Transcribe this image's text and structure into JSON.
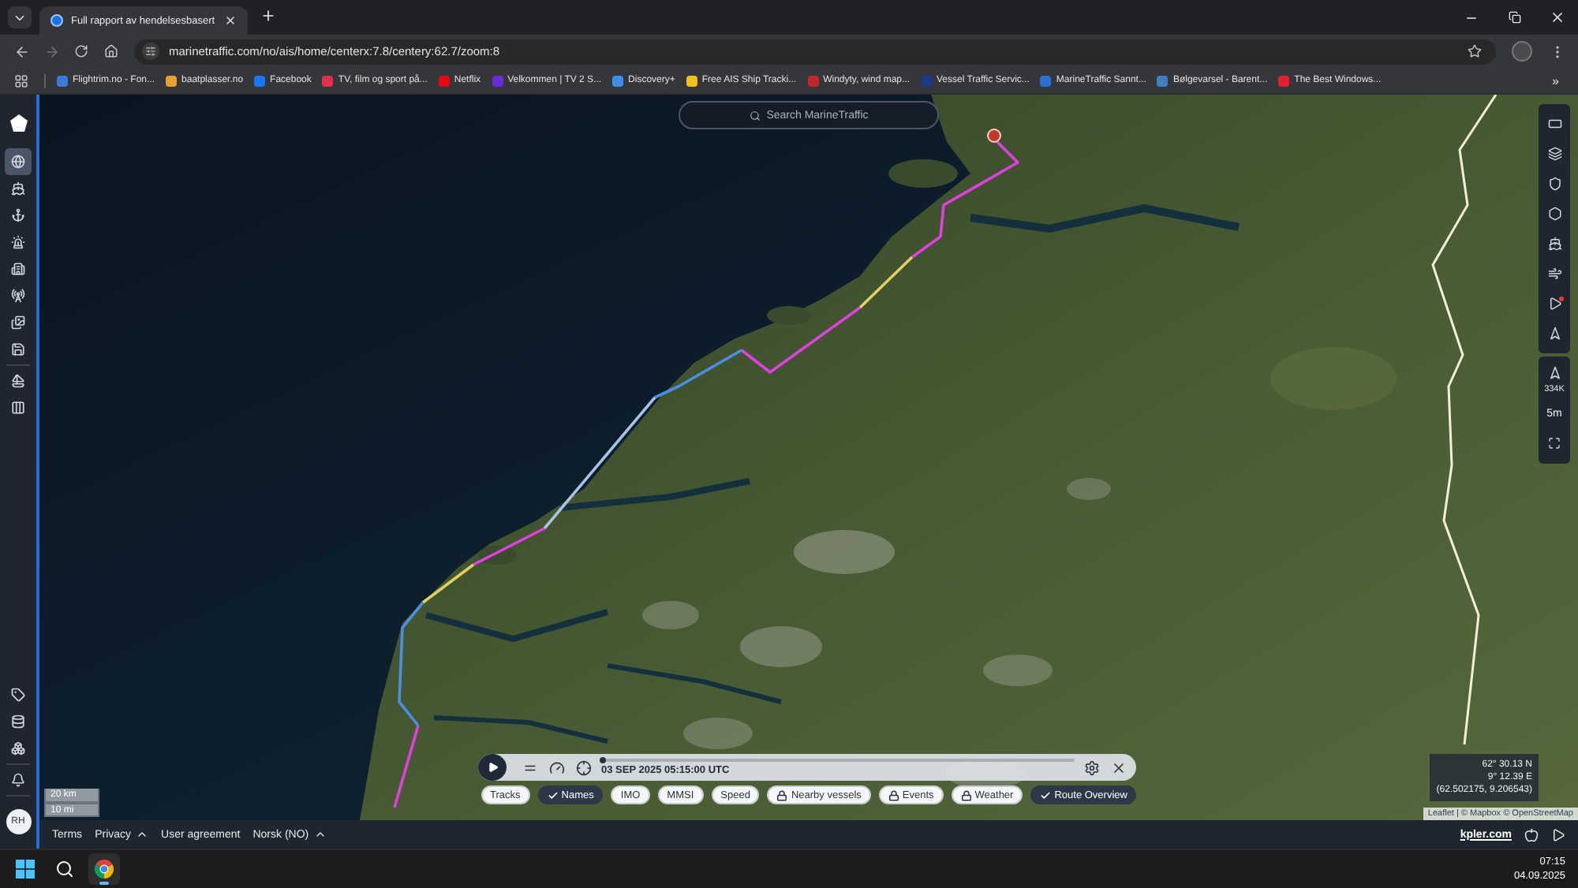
{
  "browser": {
    "tabs": [
      {
        "title": "Full rapport av hendelsesbasert",
        "selected": true
      }
    ],
    "address": "marinetraffic.com/no/ais/home/centerx:7.8/centery:62.7/zoom:8",
    "bookmarks": [
      {
        "label": "Flightrim.no - Fon...",
        "color": "#3a7bd5"
      },
      {
        "label": "baatplasser.no",
        "color": "#e8a030"
      },
      {
        "label": "Facebook",
        "color": "#1877f2"
      },
      {
        "label": "TV, film og sport på...",
        "color": "#e03050"
      },
      {
        "label": "Netflix",
        "color": "#e50914"
      },
      {
        "label": "Velkommen | TV 2 S...",
        "color": "#6a2cd8"
      },
      {
        "label": "Discovery+",
        "color": "#3a8ee6"
      },
      {
        "label": "Free AIS Ship Tracki...",
        "color": "#f0c020"
      },
      {
        "label": "Windyty, wind map...",
        "color": "#c0282a"
      },
      {
        "label": "Vessel Traffic Servic...",
        "color": "#1a3a8a"
      },
      {
        "label": "MarineTraffic Sannt...",
        "color": "#2a6ed0"
      },
      {
        "label": "Bølgevarsel - Barent...",
        "color": "#3f7fbf"
      },
      {
        "label": "The Best Windows...",
        "color": "#e02030"
      }
    ],
    "more": "»"
  },
  "sidebar": {
    "top_groups": [
      [
        {
          "kind": "globe",
          "selected": true
        },
        {
          "kind": "ship",
          "selected": false
        },
        {
          "kind": "anchor",
          "selected": false
        },
        {
          "kind": "siren",
          "selected": false
        },
        {
          "kind": "building",
          "selected": false
        },
        {
          "kind": "antenna",
          "selected": false
        },
        {
          "kind": "images",
          "selected": false
        },
        {
          "kind": "save",
          "selected": false
        }
      ],
      [
        {
          "kind": "sailboat",
          "selected": false
        },
        {
          "kind": "columns",
          "selected": false
        }
      ]
    ],
    "bottom_groups": [
      [
        {
          "kind": "tag",
          "selected": false
        },
        {
          "kind": "database",
          "selected": false
        },
        {
          "kind": "boxes",
          "selected": false
        }
      ],
      [
        {
          "kind": "bell",
          "selected": false
        }
      ]
    ],
    "avatar": "RH"
  },
  "search": {
    "placeholder": "Search MarineTraffic"
  },
  "map_toolbar": [
    {
      "kind": "panel",
      "alert": false
    },
    {
      "kind": "layers",
      "alert": false
    },
    {
      "kind": "shield",
      "alert": false
    },
    {
      "kind": "hexagon",
      "alert": false
    },
    {
      "kind": "ship",
      "alert": false
    },
    {
      "kind": "wind",
      "alert": false
    },
    {
      "kind": "play",
      "alert": true
    },
    {
      "kind": "arrow",
      "alert": false
    }
  ],
  "map_controls": {
    "count": "334K",
    "time_step": "5m"
  },
  "scale": [
    "20 km",
    "10 mi"
  ],
  "coordinates": [
    "62° 30.13 N",
    "9° 12.39 E",
    "(62.502175, 9.206543)"
  ],
  "attribution": "Leaflet | © Mapbox © OpenStreetMap",
  "playback": {
    "level": 0,
    "timestamp": "03 SEP 2025 05:15:00 UTC"
  },
  "layers": [
    {
      "label": "Tracks",
      "checked": false,
      "locked": false
    },
    {
      "label": "Names",
      "checked": true,
      "locked": false
    },
    {
      "label": "IMO",
      "checked": false,
      "locked": false
    },
    {
      "label": "MMSI",
      "checked": false,
      "locked": false
    },
    {
      "label": "Speed",
      "checked": false,
      "locked": false
    },
    {
      "label": "Nearby vessels",
      "checked": false,
      "locked": true
    },
    {
      "label": "Events",
      "checked": false,
      "locked": true
    },
    {
      "label": "Weather",
      "checked": false,
      "locked": true
    },
    {
      "label": "Route Overview",
      "checked": true,
      "locked": false
    }
  ],
  "footer": {
    "links": [
      {
        "label": "Terms",
        "dropdown": false
      },
      {
        "label": "Privacy",
        "dropdown": true
      },
      {
        "label": "User agreement",
        "dropdown": false
      },
      {
        "label": "Norsk (NO)",
        "dropdown": true
      }
    ],
    "brand_link": "kpler.com"
  },
  "taskbar": {
    "apps": [
      {
        "kind": "start",
        "running": false
      },
      {
        "kind": "search",
        "running": false
      },
      {
        "kind": "chrome",
        "running": true
      }
    ],
    "time": "07:15",
    "date": "04.09.2025"
  }
}
